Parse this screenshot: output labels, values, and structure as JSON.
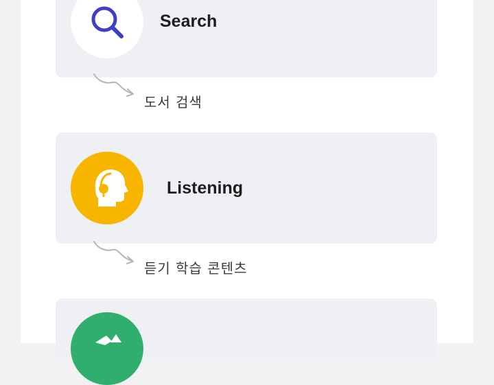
{
  "cards": [
    {
      "label": "Search",
      "icon": "search-icon",
      "icon_color": "#3f3fc2",
      "circle_color": "#ffffff"
    },
    {
      "label": "Listening",
      "icon": "headset-head-icon",
      "icon_color": "#ffffff",
      "circle_color": "#f7b500"
    },
    {
      "label": "",
      "icon": "book-share-icon",
      "icon_color": "#ffffff",
      "circle_color": "#2fae6d"
    }
  ],
  "captions": [
    "도서 검색",
    "듣기 학습 콘텐츠"
  ],
  "colors": {
    "card_bg": "#eff0f4",
    "page_bg": "#ffffff",
    "outer_bg": "#f2f2f4",
    "arrow": "#b5b5b5"
  }
}
